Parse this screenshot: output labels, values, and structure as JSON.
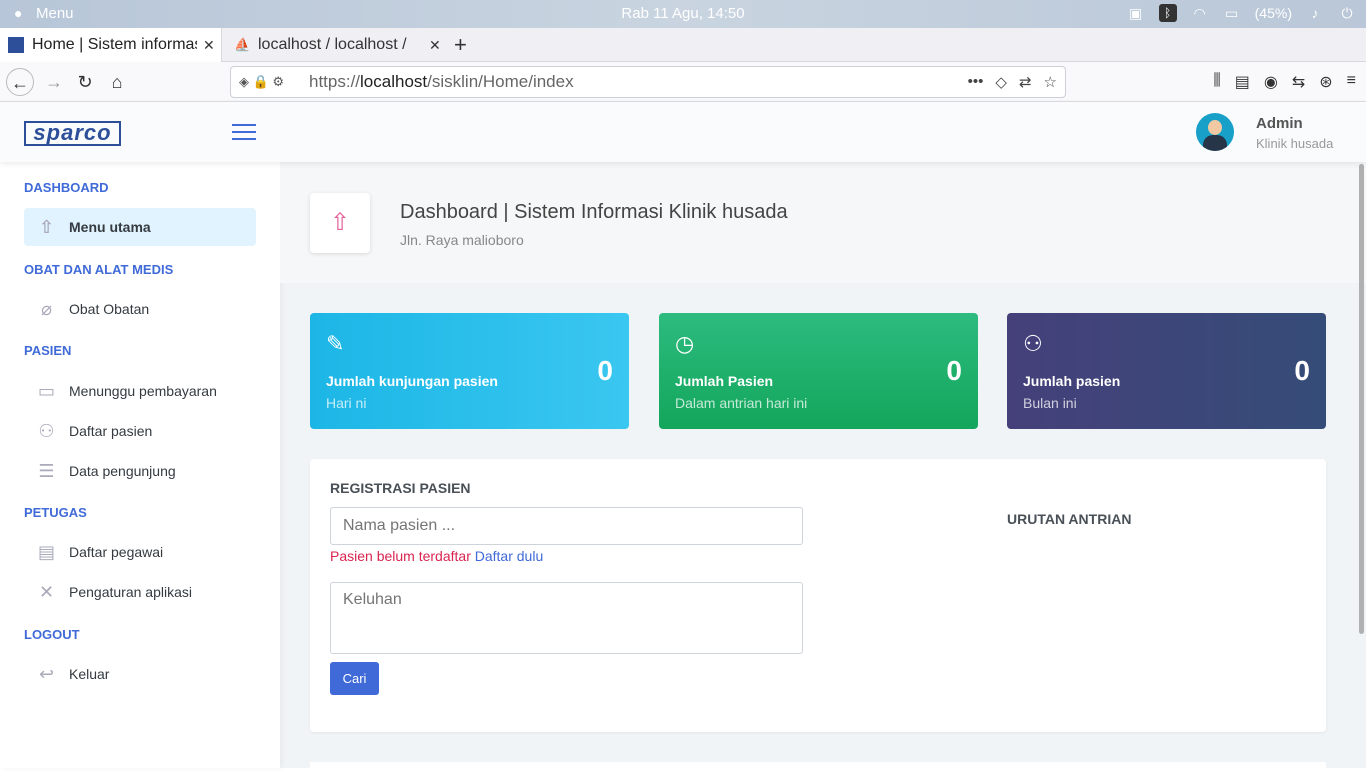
{
  "system": {
    "menu_label": "Menu",
    "clock": "Rab 11 Agu, 14:50",
    "battery": "(45%)"
  },
  "tabs": [
    {
      "title": "Home | Sistem informasi",
      "active": true
    },
    {
      "title": "localhost / localhost / ",
      "active": false
    }
  ],
  "address": {
    "url_prefix": "https://",
    "url_host": "localhost",
    "url_path": "/sisklin/Home/index"
  },
  "app": {
    "logo": "sparco",
    "user": {
      "name": "Admin",
      "role": "Klinik husada"
    }
  },
  "sidebar": {
    "sections": [
      {
        "heading": "DASHBOARD",
        "items": [
          {
            "label": "Menu utama",
            "icon": "rocket-icon",
            "active": true
          }
        ]
      },
      {
        "heading": "OBAT DAN ALAT MEDIS",
        "items": [
          {
            "label": "Obat Obatan",
            "icon": "pill-icon"
          }
        ]
      },
      {
        "heading": "PASIEN",
        "items": [
          {
            "label": "Menunggu pembayaran",
            "icon": "wallet-icon"
          },
          {
            "label": "Daftar pasien",
            "icon": "users-icon"
          },
          {
            "label": "Data pengunjung",
            "icon": "clipboard-icon"
          }
        ]
      },
      {
        "heading": "PETUGAS",
        "items": [
          {
            "label": "Daftar pegawai",
            "icon": "id-card-icon"
          },
          {
            "label": "Pengaturan aplikasi",
            "icon": "tools-icon"
          }
        ]
      },
      {
        "heading": "LOGOUT",
        "items": [
          {
            "label": "Keluar",
            "icon": "back-arrow-icon"
          }
        ]
      }
    ]
  },
  "page": {
    "title": "Dashboard | Sistem Informasi Klinik husada",
    "subtitle": "Jln. Raya malioboro"
  },
  "cards": [
    {
      "label": "Jumlah kunjungan pasien",
      "sub": "Hari ni",
      "value": "0",
      "color": "#22bfec"
    },
    {
      "label": "Jumlah Pasien",
      "sub": "Dalam antrian hari ini",
      "value": "0",
      "color": "#1fae6a"
    },
    {
      "label": "Jumlah pasien",
      "sub": "Bulan ini",
      "value": "0",
      "color": "#3f4679"
    }
  ],
  "registration": {
    "heading": "REGISTRASI PASIEN",
    "name_placeholder": "Nama pasien ...",
    "warning": "Pasien belum terdaftar",
    "register_link": "Daftar dulu",
    "complaint_placeholder": "Keluhan",
    "search_button": "Cari",
    "queue_heading": "URUTAN ANTRIAN"
  }
}
